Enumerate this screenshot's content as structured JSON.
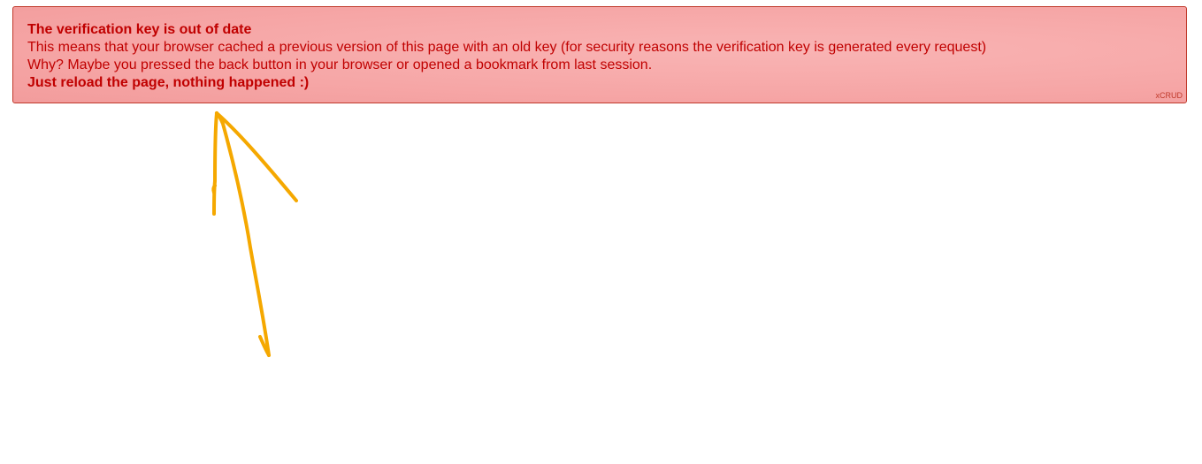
{
  "alert": {
    "title": "The verification key is out of date",
    "message_line_1": "This means that your browser cached a previous version of this page with an old key (for security reasons the verification key is generated every request)",
    "message_line_2": "Why? Maybe you pressed the back button in your browser or opened a bookmark from last session.",
    "message_line_3": "Just reload the page, nothing happened :)",
    "brand": "xCRUD",
    "text_color": "#c00000",
    "background_color": "#f6a6a6",
    "border_color": "#c0392b"
  },
  "annotation": {
    "type": "hand-drawn-arrow",
    "color": "#f5a800"
  }
}
